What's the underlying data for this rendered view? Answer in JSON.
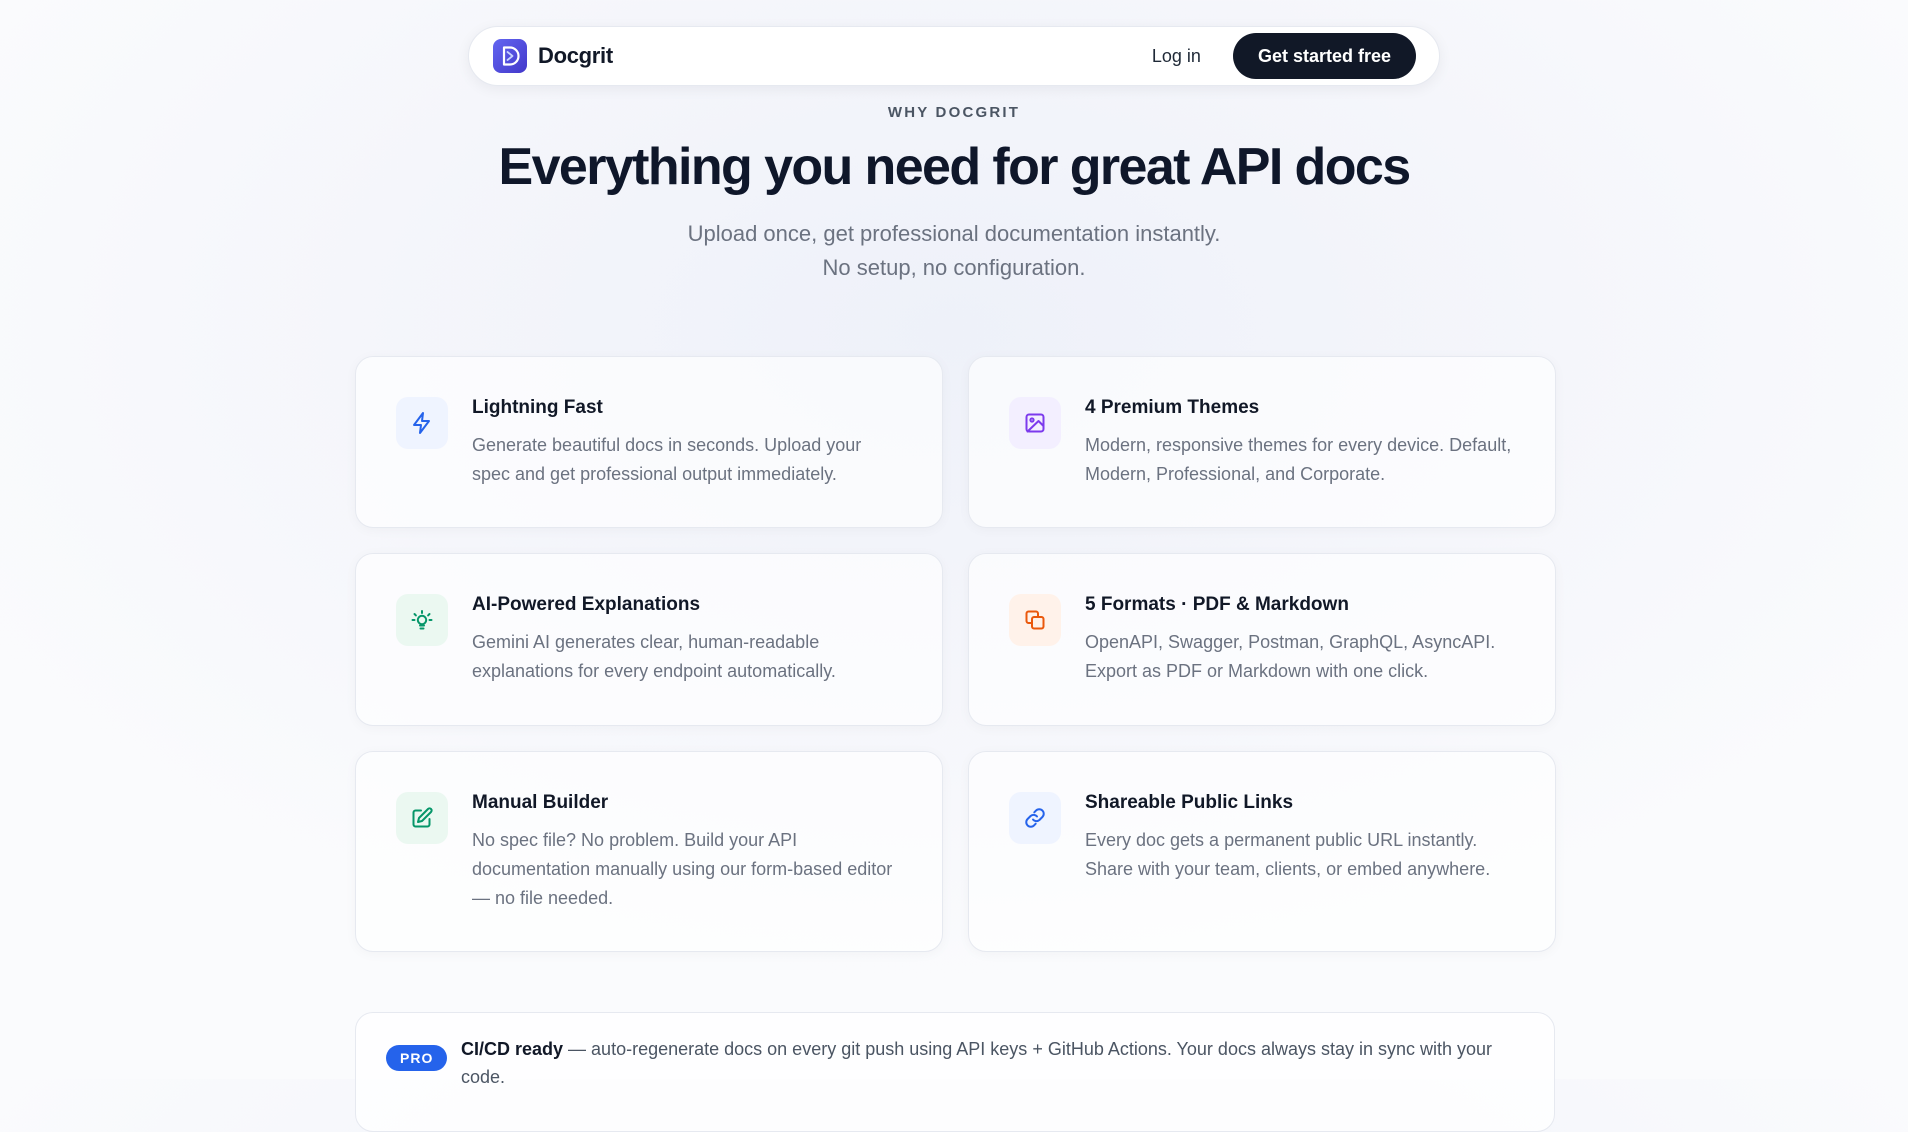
{
  "nav": {
    "logo_text": "Docgrit",
    "login_label": "Log in",
    "cta_label": "Get started free",
    "brand_color": "#4f46e5"
  },
  "hero": {
    "eyebrow": "WHY DOCGRIT",
    "headline": "Everything you need for great API docs",
    "sub_line1": "Upload once, get professional documentation instantly.",
    "sub_line2": "No setup, no configuration."
  },
  "features": [
    {
      "title": "Lightning Fast",
      "description": "Generate beautiful docs in seconds. Upload your spec and get professional output immediately.",
      "icon": "lightning-icon",
      "color": "#2563eb"
    },
    {
      "title": "4 Premium Themes",
      "description": "Modern, responsive themes for every device. Default, Modern, Professional, and Corporate.",
      "icon": "image-icon",
      "color": "#7c3aed"
    },
    {
      "title": "AI-Powered Explanations",
      "description": "Gemini AI generates clear, human-readable explanations for every endpoint automatically.",
      "icon": "lightbulb-icon",
      "color": "#059669"
    },
    {
      "title": "5 Formats · PDF & Markdown",
      "description": "OpenAPI, Swagger, Postman, GraphQL, AsyncAPI. Export as PDF or Markdown with one click.",
      "icon": "copy-icon",
      "color": "#ea580c"
    },
    {
      "title": "Manual Builder",
      "description": "No spec file? No problem. Build your API documentation manually using our form-based editor — no file needed.",
      "icon": "edit-icon",
      "color": "#059669"
    },
    {
      "title": "Shareable Public Links",
      "description": "Every doc gets a permanent public URL instantly. Share with your team, clients, or embed anywhere.",
      "icon": "link-icon",
      "color": "#2563eb"
    }
  ],
  "pro": {
    "badge": "PRO",
    "title": "CI/CD ready",
    "text": " — auto-regenerate docs on every git push using API keys + GitHub Actions. Your docs always stay in sync with your code."
  }
}
